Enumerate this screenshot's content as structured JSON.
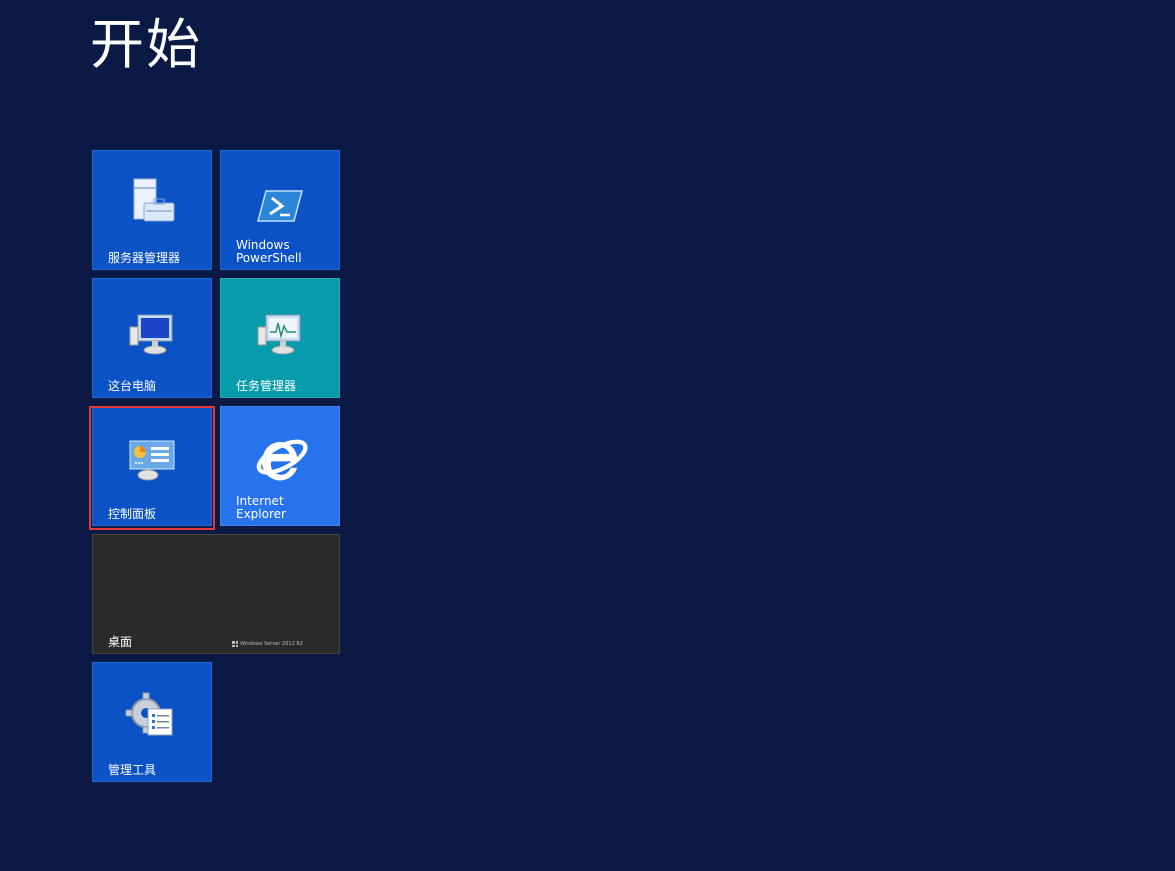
{
  "start": {
    "title": "开始"
  },
  "tiles": [
    {
      "id": "server-manager",
      "label": "服务器管理器",
      "icon": "server-manager-icon",
      "color": "#0a52c5"
    },
    {
      "id": "powershell",
      "label": "Windows\nPowerShell",
      "icon": "powershell-icon",
      "color": "#0a52c5"
    },
    {
      "id": "this-pc",
      "label": "这台电脑",
      "icon": "computer-icon",
      "color": "#0a52c5"
    },
    {
      "id": "task-manager",
      "label": "任务管理器",
      "icon": "task-manager-icon",
      "color": "#079cac"
    },
    {
      "id": "control-panel",
      "label": "控制面板",
      "icon": "control-panel-icon",
      "color": "#0a52c5",
      "selected": true
    },
    {
      "id": "internet-explorer",
      "label": "Internet\nExplorer",
      "icon": "internet-explorer-icon",
      "color": "#2673ec"
    },
    {
      "id": "desktop",
      "label": "桌面",
      "icon": "desktop-wallpaper",
      "color": "#2a2a2a",
      "brand": "Windows Server 2012 R2"
    },
    {
      "id": "admin-tools",
      "label": "管理工具",
      "icon": "admin-tools-icon",
      "color": "#0a52c5"
    }
  ],
  "colors": {
    "background": "#0a1a45",
    "selection_outline": "#e23a3a"
  }
}
